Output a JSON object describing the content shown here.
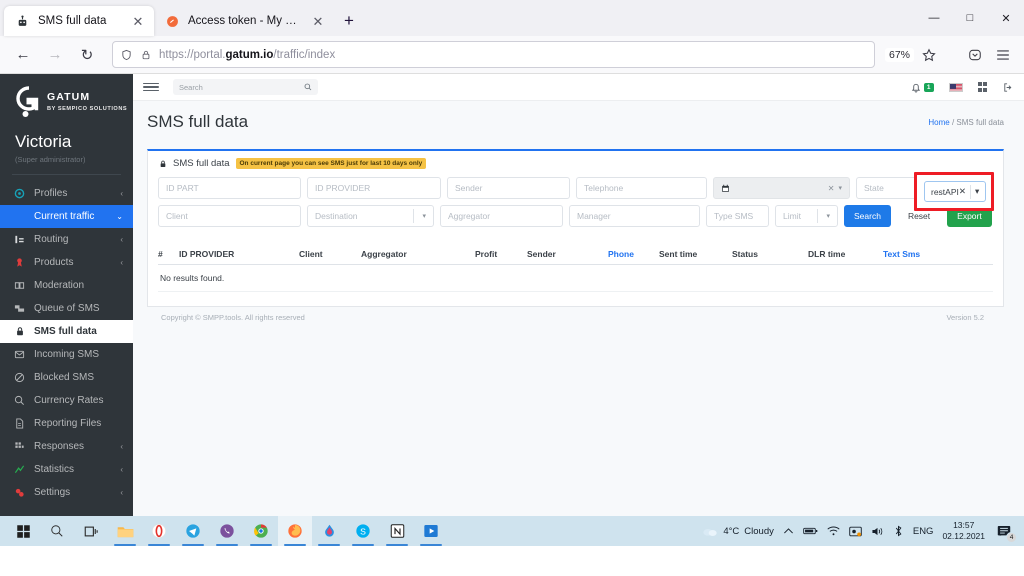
{
  "browser": {
    "tabs": [
      {
        "title": "SMS full data",
        "favicon": "sms-robot-icon",
        "active": true
      },
      {
        "title": "Access token - My Workspace",
        "favicon": "postman-icon",
        "active": false
      }
    ],
    "new_tab_label": "+",
    "window_controls": {
      "minimize": "─",
      "maximize": "❐",
      "close": "✕"
    },
    "nav": {
      "back": "←",
      "forward": "→",
      "reload": "↻"
    },
    "url": {
      "prefix": "https://portal.",
      "domain": "gatum.io",
      "path": "/traffic/index"
    },
    "zoom_level": "67%",
    "icons": [
      "shield-icon",
      "lock-icon",
      "star-icon",
      "pocket-icon",
      "hamburger-menu-icon"
    ]
  },
  "sidebar": {
    "brand": {
      "name": "GATUM",
      "subtitle": "BY SEMPICO SOLUTIONS"
    },
    "user": {
      "name": "Victoria",
      "role": "(Super administrator)"
    },
    "items": [
      {
        "label": "Profiles",
        "icon": "profiles-icon",
        "caret": "‹",
        "state": "normal"
      },
      {
        "label": "Current traffic",
        "icon": "",
        "caret": "⌄",
        "state": "active"
      },
      {
        "label": "Routing",
        "icon": "routing-icon",
        "caret": "‹",
        "state": "normal"
      },
      {
        "label": "Products",
        "icon": "products-icon",
        "caret": "‹",
        "state": "normal"
      },
      {
        "label": "Moderation",
        "icon": "moderation-icon",
        "caret": "",
        "state": "normal"
      },
      {
        "label": "Queue of SMS",
        "icon": "queue-icon",
        "caret": "",
        "state": "normal"
      },
      {
        "label": "SMS full data",
        "icon": "lock-icon",
        "caret": "",
        "state": "current"
      },
      {
        "label": "Incoming SMS",
        "icon": "envelope-icon",
        "caret": "",
        "state": "normal"
      },
      {
        "label": "Blocked SMS",
        "icon": "blocked-icon",
        "caret": "",
        "state": "normal"
      },
      {
        "label": "Currency Rates",
        "icon": "magnifier-icon",
        "caret": "",
        "state": "normal"
      },
      {
        "label": "Reporting Files",
        "icon": "file-icon",
        "caret": "",
        "state": "normal"
      },
      {
        "label": "Responses",
        "icon": "responses-icon",
        "caret": "‹",
        "state": "normal"
      },
      {
        "label": "Statistics",
        "icon": "chart-icon",
        "caret": "‹",
        "state": "normal"
      },
      {
        "label": "Settings",
        "icon": "gears-icon",
        "caret": "‹",
        "state": "normal"
      }
    ]
  },
  "topbar": {
    "search_placeholder": "Search",
    "notification_count": "1",
    "language_flag": "us-flag-icon",
    "icons": [
      "hamburger-icon",
      "search-icon",
      "notifications-icon",
      "flag-icon",
      "apps-grid-icon",
      "logout-icon"
    ]
  },
  "page": {
    "title": "SMS full data",
    "breadcrumb": {
      "home": "Home",
      "separator": "/",
      "current": "SMS full data"
    }
  },
  "card": {
    "header_title": "SMS full data",
    "warning": "On current page you can see SMS just for last 10 days only"
  },
  "filters": {
    "row1": [
      {
        "name": "id-part",
        "placeholder": "ID PART",
        "type": "text",
        "value": ""
      },
      {
        "name": "id-provider",
        "placeholder": "ID PROVIDER",
        "type": "text",
        "value": ""
      },
      {
        "name": "sender",
        "placeholder": "Sender",
        "type": "text",
        "value": ""
      },
      {
        "name": "telephone",
        "placeholder": "Telephone",
        "type": "text",
        "value": ""
      },
      {
        "name": "date-range",
        "placeholder": "",
        "type": "date",
        "value": ""
      },
      {
        "name": "state",
        "placeholder": "State",
        "type": "text",
        "value": ""
      }
    ],
    "row2": [
      {
        "name": "client",
        "placeholder": "Client",
        "type": "text",
        "value": ""
      },
      {
        "name": "destination",
        "placeholder": "Destination",
        "type": "select",
        "value": ""
      },
      {
        "name": "aggregator",
        "placeholder": "Aggregator",
        "type": "text",
        "value": ""
      },
      {
        "name": "manager",
        "placeholder": "Manager",
        "type": "text",
        "value": ""
      },
      {
        "name": "type-sms",
        "placeholder": "Type SMS",
        "type": "text",
        "value": ""
      },
      {
        "name": "limit",
        "placeholder": "Limit",
        "type": "select",
        "value": ""
      }
    ],
    "restapi": {
      "label": "restAPI",
      "clear": "×",
      "caret": "▾"
    },
    "buttons": {
      "search": "Search",
      "reset": "Reset",
      "export": "Export"
    }
  },
  "table": {
    "columns": [
      {
        "label": "#",
        "link": false
      },
      {
        "label": "ID PROVIDER",
        "link": false
      },
      {
        "label": "Client",
        "link": false
      },
      {
        "label": "Aggregator",
        "link": false
      },
      {
        "label": "Profit",
        "link": false
      },
      {
        "label": "Sender",
        "link": false
      },
      {
        "label": "Phone",
        "link": true
      },
      {
        "label": "Sent time",
        "link": false
      },
      {
        "label": "Status",
        "link": false
      },
      {
        "label": "DLR time",
        "link": false
      },
      {
        "label": "Text Sms",
        "link": true
      }
    ],
    "empty_message": "No results found."
  },
  "footer": {
    "copyright": "Copyright © SMPP.tools. All rights reserved",
    "version": "Version 5.2"
  },
  "taskbar": {
    "start": "windows-start-icon",
    "items": [
      "search-icon",
      "task-view-icon",
      "file-explorer-icon",
      "opera-icon",
      "telegram-icon",
      "viber-icon",
      "chrome-icon",
      "firefox-icon",
      "water-drop-icon",
      "skype-icon",
      "notion-icon",
      "media-player-icon"
    ],
    "weather": {
      "temp": "4°C",
      "condition": "Cloudy"
    },
    "tray": [
      "chevron-up-icon",
      "battery-icon",
      "wifi-icon",
      "onedrive-icon",
      "volume-icon",
      "bluetooth-icon"
    ],
    "language": "ENG",
    "clock": {
      "time": "13:57",
      "date": "02.12.2021"
    },
    "notification_count": "4"
  },
  "colors": {
    "accent": "#2173f0",
    "sidebar_bg": "#2f353a",
    "success": "#22a24c",
    "warning": "#f5c244",
    "highlight_box": "#ee1c25"
  }
}
